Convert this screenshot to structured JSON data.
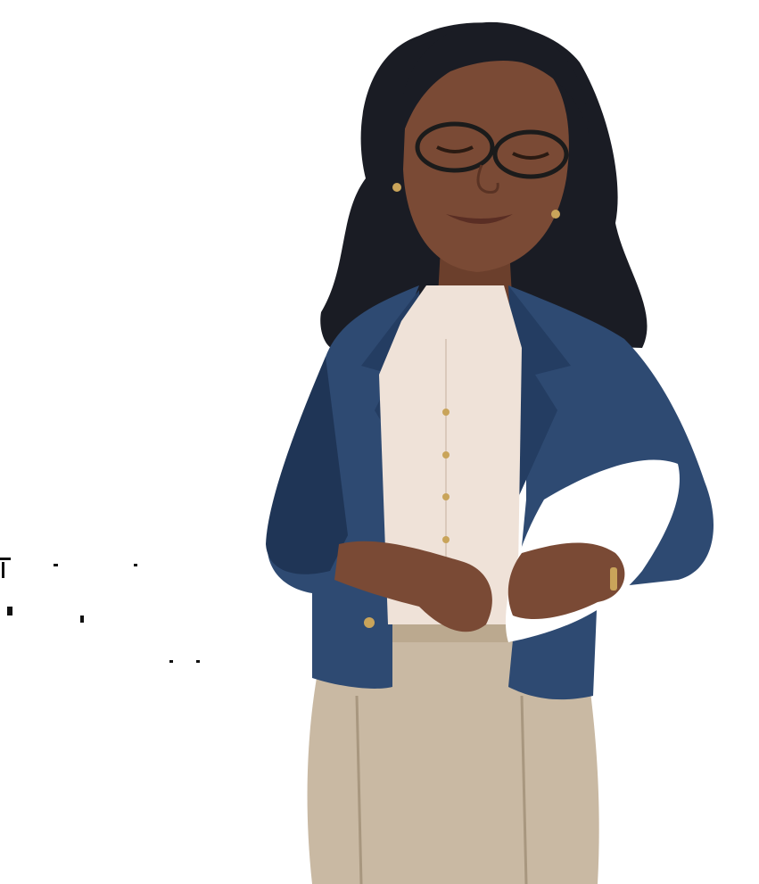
{
  "image": {
    "subject": "illustrated-woman",
    "background": "#ffffff",
    "colors": {
      "skin": "#7a4a35",
      "skin_shadow": "#5a3324",
      "hair": "#1a1c24",
      "blazer": "#2e4a72",
      "blazer_shadow": "#1f3556",
      "blouse": "#efe2d8",
      "trousers": "#c9b9a3",
      "trousers_shadow": "#a8977f",
      "glasses": "#1b1b1b",
      "buttons": "#c9a45a",
      "folder": "#ffffff"
    }
  }
}
